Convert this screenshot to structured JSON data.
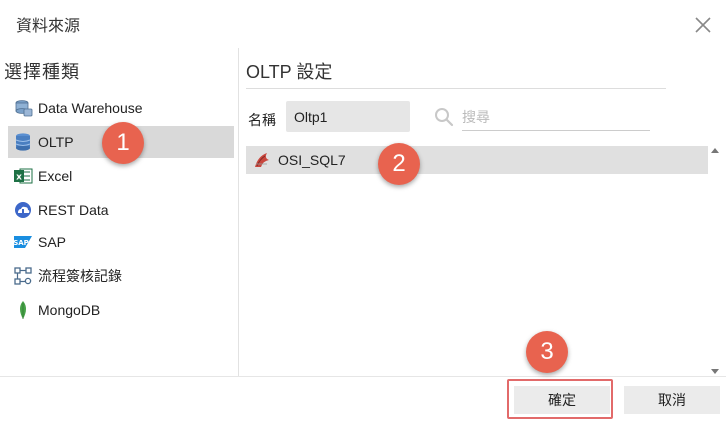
{
  "dialog": {
    "title": "資料來源"
  },
  "left": {
    "heading": "選擇種類",
    "items": [
      {
        "label": "Data Warehouse",
        "icon": "database-stack-icon"
      },
      {
        "label": "OLTP",
        "icon": "database-icon",
        "selected": true
      },
      {
        "label": "Excel",
        "icon": "excel-icon"
      },
      {
        "label": "REST Data",
        "icon": "cloud-icon"
      },
      {
        "label": "SAP",
        "icon": "sap-icon"
      },
      {
        "label": "流程簽核記錄",
        "icon": "workflow-icon"
      },
      {
        "label": "MongoDB",
        "icon": "mongodb-leaf-icon"
      }
    ]
  },
  "right": {
    "heading": "OLTP 設定",
    "name_label": "名稱",
    "name_value": "Oltp1",
    "search_placeholder": "搜尋",
    "connections": [
      {
        "label": "OSI_SQL7",
        "icon": "sql-server-icon",
        "selected": true
      }
    ]
  },
  "footer": {
    "ok_label": "確定",
    "cancel_label": "取消"
  },
  "markers": [
    "1",
    "2",
    "3"
  ],
  "colors": {
    "marker": "#e8634f",
    "highlight_border": "#e26a6a",
    "selected_bg": "#d9d9d9"
  }
}
